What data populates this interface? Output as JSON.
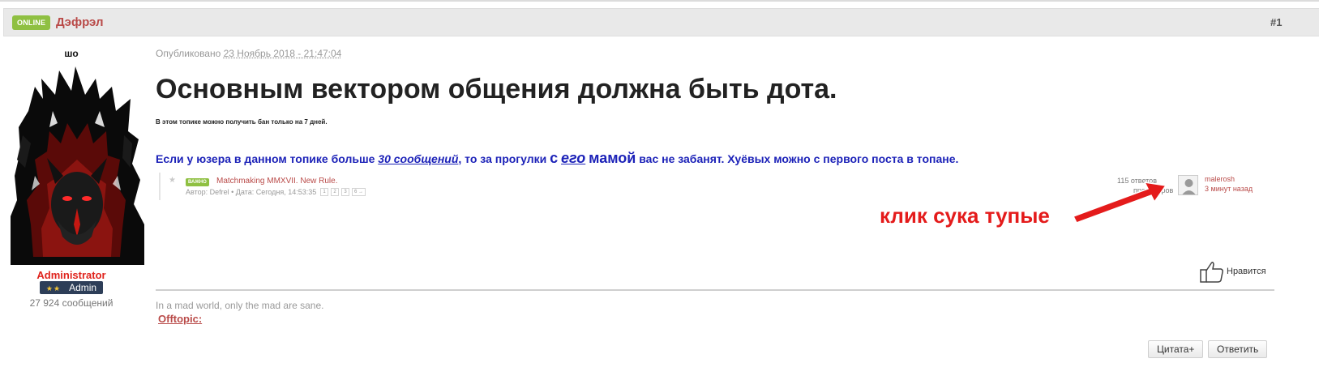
{
  "header": {
    "online_badge": "ONLINE",
    "author_name": "Дэфрэл",
    "post_number": "#1"
  },
  "sidebar": {
    "avatar_title": "шо",
    "role": "Administrator",
    "rank_label": "Admin",
    "rank_stars": "★★",
    "post_count": "27 924 сообщений"
  },
  "post": {
    "published_prefix": "Опубликовано",
    "published_date": "23 Ноябрь 2018 - 21:47:04",
    "title": "Основным вектором общения должна быть дота.",
    "ban_note": "В этом топике можно получить бан только на 7 дней.",
    "rule": {
      "part1": "Если у юзера в данном топике больше ",
      "count": "30 сообщений",
      "part2": ", то за прогулки ",
      "s": "с",
      "ego": "его",
      "mamoy": "мамой",
      "part3": " вас не забанят. Хуёвых можно с первого поста в топане."
    },
    "topic": {
      "star_icon": "star-icon",
      "badge": "ВАЖНО",
      "title": "Matchmaking MMXVII. New Rule.",
      "meta": "Автор: Defrel • Дата: Сегодня, 14:53:35",
      "pages": [
        "1",
        "2",
        "3",
        "6 →"
      ],
      "replies": "115 ответов",
      "views": "просмотров",
      "last_user": "malerosh",
      "last_time": "3 минут назад"
    },
    "annotation": "клик сука тупые",
    "like_label": "Нравится",
    "signature": "In a mad world, only the mad are sane.",
    "offtopic": "Offtopic:",
    "quote_button": "Цитата+",
    "reply_button": "Ответить"
  },
  "colors": {
    "accent_green": "#8fc042",
    "author_red": "#b94a48",
    "rule_blue": "#1c22b8",
    "annotation_red": "#e41b1b",
    "rank_navy": "#2d3e58"
  }
}
